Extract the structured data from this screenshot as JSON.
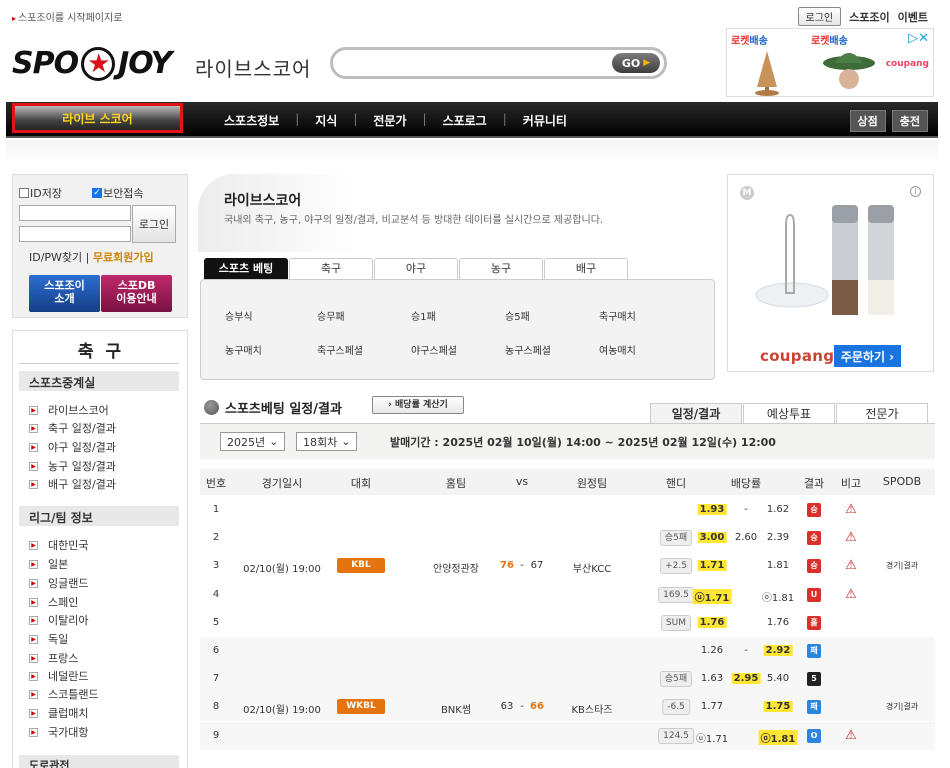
{
  "header": {
    "home_link": "스포조이를 시작페이지로",
    "login": "로그인",
    "spojoy": "스포조이",
    "event": "이벤트",
    "logo_left": "SPO",
    "logo_right": "JOY",
    "logo_sub": "라이브스코어",
    "search_placeholder": "",
    "go": "GO"
  },
  "top_ad": {
    "tag1_rocket": "로켓",
    "tag1_text": "배송",
    "tag2_rocket": "로켓",
    "tag2_text": "배송",
    "brand": "coupang"
  },
  "nav": {
    "live": "라이브 스코어",
    "menu": [
      "스포츠정보",
      "지식",
      "전문가",
      "스포로그",
      "커뮤니티"
    ],
    "shop": "상점",
    "charge": "충전"
  },
  "login": {
    "save_id": "ID저장",
    "secure": "보안접속",
    "button": "로그인",
    "find": "ID/PW찾기",
    "join": "무료회원가입",
    "btn_about": [
      "스포조이",
      "소개"
    ],
    "btn_db": [
      "스포DB",
      "이용안내"
    ]
  },
  "side": {
    "title": "축 구",
    "head1": "스포츠중계실",
    "items1": [
      "라이브스코어",
      "축구 일정/결과",
      "야구 일정/결과",
      "농구 일정/결과",
      "배구 일정/결과"
    ],
    "head2": "리그/팀 정보",
    "items2": [
      "대한민국",
      "일본",
      "잉글랜드",
      "스페인",
      "이탈리아",
      "독일",
      "프랑스",
      "네덜란드",
      "스코틀랜드",
      "클럽매치",
      "국가대항"
    ],
    "head3": "도로관전"
  },
  "livescore": {
    "title": "라이브스코어",
    "desc": "국내외 축구, 농구, 야구의 일정/결과, 비교분석 등 방대한 데이터를 실시간으로 제공합니다.",
    "tabs": [
      "스포츠 베팅",
      "축구",
      "야구",
      "농구",
      "배구"
    ],
    "panel_row1": [
      "승부식",
      "승무패",
      "승1패",
      "승5패",
      "축구매치"
    ],
    "panel_row2": [
      "농구매치",
      "축구스페셜",
      "야구스페셜",
      "농구스페셜",
      "여농매치"
    ]
  },
  "side_ad": {
    "brand": "coupang",
    "cta": "주문하기 ›"
  },
  "betting": {
    "title": "스포츠베팅 일정/결과",
    "calc": "› 배당률 계산기",
    "tabs": [
      "일정/결과",
      "예상투표",
      "전문가"
    ],
    "year": "2025년",
    "round": "18회차",
    "period": "발매기간 : 2025년 02월 10일(월) 14:00 ~ 2025년 02월 12일(수) 12:00",
    "columns": [
      "번호",
      "경기일시",
      "대회",
      "홈팀",
      "vs",
      "원정팀",
      "핸디",
      "배당률",
      "결과",
      "비고",
      "SPODB"
    ],
    "rows": [
      {
        "no": "1",
        "date": "",
        "league": "",
        "home": "",
        "hs": "",
        "as": "",
        "away": "",
        "handi": "",
        "o1": "1.93",
        "o2": "-",
        "o3": "1.62",
        "hl": 1,
        "res": "승",
        "res_color": "#d9302a",
        "warn": true,
        "spodb": ""
      },
      {
        "no": "2",
        "date": "",
        "league": "",
        "home": "",
        "hs": "",
        "as": "",
        "away": "",
        "handi": "승5패",
        "o1": "3.00",
        "o2": "2.60",
        "o3": "2.39",
        "hl": 1,
        "res": "승",
        "res_color": "#d9302a",
        "warn": true,
        "spodb": ""
      },
      {
        "no": "3",
        "date": "02/10(월) 19:00",
        "league": "KBL",
        "home": "안양정관장",
        "hs": "76",
        "as": "67",
        "away": "부산KCC",
        "handi": "+2.5",
        "o1": "1.71",
        "o2": "",
        "o3": "1.81",
        "hl": 1,
        "res": "승",
        "res_color": "#d9302a",
        "warn": true,
        "spodb": "경기|결과"
      },
      {
        "no": "4",
        "date": "",
        "league": "",
        "home": "",
        "hs": "",
        "as": "",
        "away": "",
        "handi": "169.5",
        "o1": "ⓤ1.71",
        "o2": "",
        "o3": "ⓞ1.81",
        "hl": 1,
        "res": "U",
        "res_color": "#d9302a",
        "warn": true,
        "spodb": ""
      },
      {
        "no": "5",
        "date": "",
        "league": "",
        "home": "",
        "hs": "",
        "as": "",
        "away": "",
        "handi": "SUM",
        "o1": "1.76",
        "o2": "",
        "o3": "1.76",
        "hl": 1,
        "res": "홀",
        "res_color": "#d9302a",
        "warn": false,
        "spodb": ""
      },
      {
        "no": "6",
        "date": "",
        "league": "",
        "home": "",
        "hs": "",
        "as": "",
        "away": "",
        "handi": "",
        "o1": "1.26",
        "o2": "-",
        "o3": "2.92",
        "hl": 3,
        "res": "패",
        "res_color": "#2a86e0",
        "warn": false,
        "spodb": ""
      },
      {
        "no": "7",
        "date": "",
        "league": "",
        "home": "",
        "hs": "",
        "as": "",
        "away": "",
        "handi": "승5패",
        "o1": "1.63",
        "o2": "2.95",
        "o3": "5.40",
        "hl": 2,
        "res": "5",
        "res_color": "#222",
        "warn": false,
        "spodb": ""
      },
      {
        "no": "8",
        "date": "02/10(월) 19:00",
        "league": "WKBL",
        "home": "BNK썸",
        "hs": "63",
        "as": "66",
        "away": "KB스타즈",
        "handi": "-6.5",
        "o1": "1.77",
        "o2": "",
        "o3": "1.75",
        "hl": 3,
        "res": "패",
        "res_color": "#2a86e0",
        "warn": false,
        "spodb": "경기|결과"
      },
      {
        "no": "9",
        "date": "",
        "league": "",
        "home": "",
        "hs": "",
        "as": "",
        "away": "",
        "handi": "124.5",
        "o1": "ⓤ1.71",
        "o2": "",
        "o3": "ⓞ1.81",
        "hl": 3,
        "res": "O",
        "res_color": "#2a86e0",
        "warn": true,
        "spodb": ""
      }
    ]
  }
}
